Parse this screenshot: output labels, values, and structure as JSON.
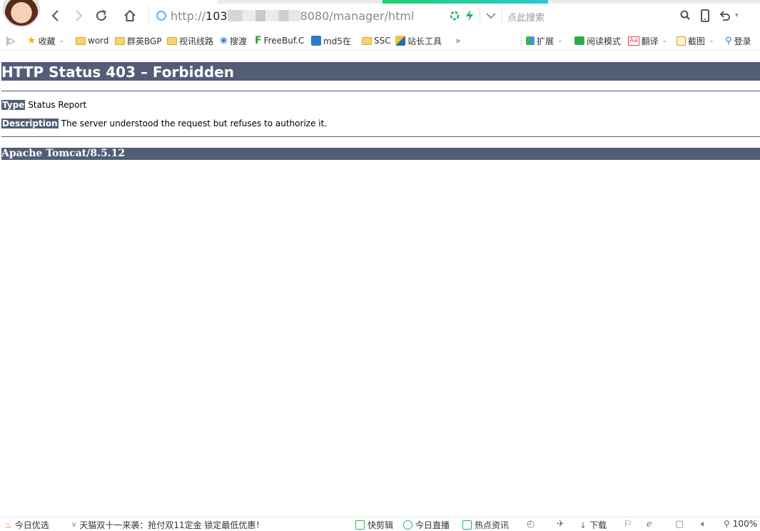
{
  "browser": {
    "url": {
      "scheme": "http://",
      "host_visible_prefix": "103",
      "rest": "8080/manager/html"
    },
    "search_placeholder": "点此搜索",
    "bookmarks": [
      {
        "label": "收藏",
        "icon": "star-icon"
      },
      {
        "label": "word",
        "icon": "folder-icon"
      },
      {
        "label": "群英BGP",
        "icon": "folder-icon"
      },
      {
        "label": "视讯线路",
        "icon": "folder-icon"
      },
      {
        "label": "搜渡",
        "icon": "baidu-paw-icon"
      },
      {
        "label": "FreeBuf.C",
        "icon": "freebuf-icon"
      },
      {
        "label": "md5在",
        "icon": "md5-icon"
      },
      {
        "label": "SSC",
        "icon": "folder-icon"
      },
      {
        "label": "站长工具",
        "icon": "chinaz-icon"
      }
    ],
    "bookmarks_more": "»",
    "right_tools": [
      {
        "label": "扩展",
        "icon": "extension-icon"
      },
      {
        "label": "阅读模式",
        "icon": "book-icon"
      },
      {
        "label": "翻译",
        "icon": "translate-icon"
      },
      {
        "label": "截图",
        "icon": "screenshot-icon"
      },
      {
        "label": "登录",
        "icon": "login-icon"
      }
    ]
  },
  "page": {
    "title": "HTTP Status 403 – Forbidden",
    "type_label": "Type",
    "type_value": "Status Report",
    "description_label": "Description",
    "description_value": "The server understood the request but refuses to authorize it.",
    "server_footer": "Apache Tomcat/8.5.12"
  },
  "statusbar": {
    "left": [
      {
        "label": "今日优选",
        "icon": "fire-icon"
      },
      {
        "label": "天猫双十一来袭：抢付双11定金 锁定最低优惠！",
        "icon": "chevron-down-icon"
      }
    ],
    "right": [
      {
        "label": "快剪辑",
        "icon": "video-clip-icon"
      },
      {
        "label": "今日直播",
        "icon": "live-play-icon"
      },
      {
        "label": "热点资讯",
        "icon": "news-icon"
      },
      {
        "label": "下载",
        "icon": "download-icon"
      }
    ],
    "zoom": "100%"
  }
}
